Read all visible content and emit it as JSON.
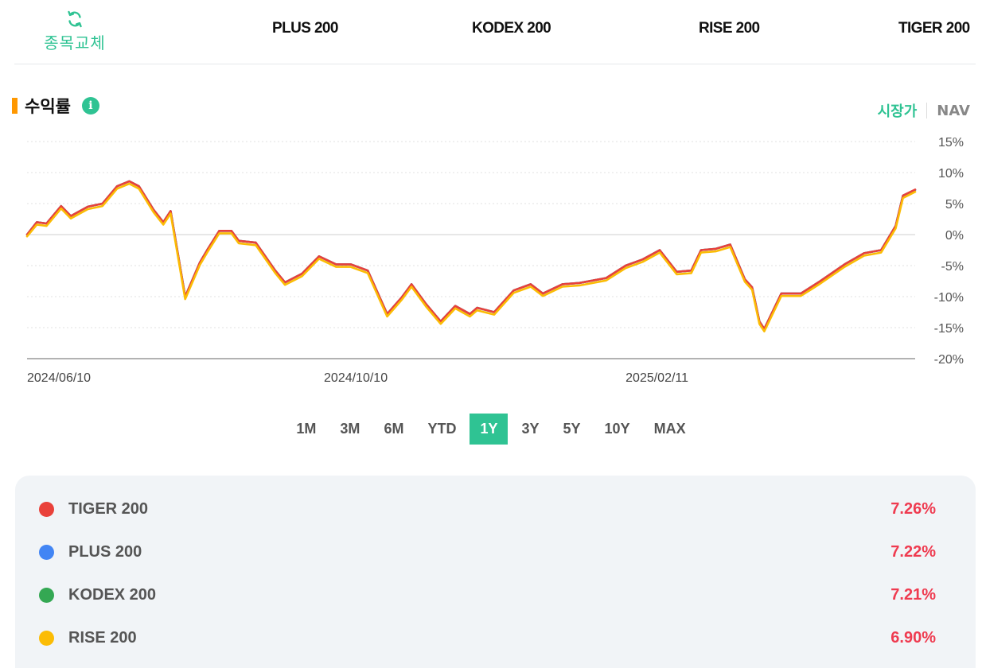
{
  "header": {
    "swap_label": "종목교체",
    "tabs": [
      "PLUS 200",
      "KODEX 200",
      "RISE 200",
      "TIGER 200"
    ]
  },
  "section": {
    "title": "수익률",
    "info_icon": "i",
    "toggle": {
      "active": "시장가",
      "inactive": "NAV"
    }
  },
  "periods": {
    "options": [
      "1M",
      "3M",
      "6M",
      "YTD",
      "1Y",
      "3Y",
      "5Y",
      "10Y",
      "MAX"
    ],
    "selected": "1Y"
  },
  "legend": [
    {
      "name": "TIGER 200",
      "value": "7.26%",
      "color": "#e9413a"
    },
    {
      "name": "PLUS 200",
      "value": "7.22%",
      "color": "#4285f4"
    },
    {
      "name": "KODEX 200",
      "value": "7.21%",
      "color": "#34a853"
    },
    {
      "name": "RISE 200",
      "value": "6.90%",
      "color": "#fbbc05"
    }
  ],
  "colors": {
    "accent": "#2fc393",
    "title_marker": "#ff9800",
    "positive": "#ef3b50"
  },
  "chart_data": {
    "type": "line",
    "y_unit": "%",
    "ylim": [
      -20,
      15
    ],
    "y_ticks": [
      15,
      10,
      5,
      0,
      -5,
      -10,
      -15,
      -20
    ],
    "y_tick_labels": [
      "15%",
      "10%",
      "5%",
      "0%",
      "-5%",
      "-10%",
      "-15%",
      "-20%"
    ],
    "x_start": "2024-06-10",
    "x_end": "2025-06-10",
    "x_tick_labels": [
      {
        "date": "2024-06-10",
        "label": "2024/06/10"
      },
      {
        "date": "2024-10-10",
        "label": "2024/10/10"
      },
      {
        "date": "2025-02-11",
        "label": "2025/02/11"
      }
    ],
    "x": [
      "2024-06-10",
      "2024-06-14",
      "2024-06-18",
      "2024-06-24",
      "2024-06-28",
      "2024-07-05",
      "2024-07-11",
      "2024-07-17",
      "2024-07-22",
      "2024-07-26",
      "2024-08-01",
      "2024-08-05",
      "2024-08-08",
      "2024-08-14",
      "2024-08-20",
      "2024-08-23",
      "2024-08-28",
      "2024-09-02",
      "2024-09-05",
      "2024-09-12",
      "2024-09-20",
      "2024-09-24",
      "2024-10-01",
      "2024-10-08",
      "2024-10-15",
      "2024-10-21",
      "2024-10-28",
      "2024-11-05",
      "2024-11-11",
      "2024-11-15",
      "2024-11-21",
      "2024-11-27",
      "2024-12-03",
      "2024-12-09",
      "2024-12-12",
      "2024-12-19",
      "2024-12-27",
      "2025-01-03",
      "2025-01-08",
      "2025-01-16",
      "2025-01-23",
      "2025-02-03",
      "2025-02-11",
      "2025-02-18",
      "2025-02-25",
      "2025-03-04",
      "2025-03-10",
      "2025-03-14",
      "2025-03-20",
      "2025-03-26",
      "2025-04-01",
      "2025-04-04",
      "2025-04-07",
      "2025-04-09",
      "2025-04-16",
      "2025-04-24",
      "2025-05-02",
      "2025-05-12",
      "2025-05-20",
      "2025-05-27",
      "2025-06-02",
      "2025-06-05",
      "2025-06-10"
    ],
    "series": [
      {
        "name": "TIGER 200",
        "color": "#e9413a",
        "values": [
          0,
          2,
          1.8,
          4.6,
          3,
          4.5,
          5,
          7.8,
          8.6,
          7.8,
          4,
          2,
          3.8,
          -10,
          -4.5,
          -2.5,
          0.6,
          0.6,
          -1,
          -1.3,
          -5.8,
          -7.7,
          -6.3,
          -3.5,
          -4.8,
          -4.8,
          -5.8,
          -12.8,
          -10.1,
          -8,
          -11.2,
          -14,
          -11.5,
          -12.8,
          -11.8,
          -12.5,
          -9,
          -8,
          -9.5,
          -8,
          -7.8,
          -7,
          -5,
          -4,
          -2.5,
          -6,
          -5.8,
          -2.5,
          -2.3,
          -1.6,
          -7.2,
          -8.5,
          -14,
          -15.2,
          -9.5,
          -9.5,
          -7.5,
          -4.8,
          -3,
          -2.5,
          1.4,
          6.3,
          7.26
        ]
      },
      {
        "name": "PLUS 200",
        "color": "#4285f4",
        "values": [
          0,
          2,
          1.8,
          4.6,
          3,
          4.5,
          5,
          7.8,
          8.6,
          7.8,
          4,
          2,
          3.8,
          -10,
          -4.5,
          -2.5,
          0.6,
          0.6,
          -1,
          -1.3,
          -5.8,
          -7.7,
          -6.3,
          -3.5,
          -4.8,
          -4.8,
          -5.8,
          -12.8,
          -10.1,
          -8,
          -11.2,
          -14,
          -11.5,
          -12.8,
          -11.8,
          -12.5,
          -9,
          -8,
          -9.5,
          -8,
          -7.8,
          -7,
          -5,
          -4,
          -2.5,
          -6,
          -5.8,
          -2.5,
          -2.3,
          -1.6,
          -7.2,
          -8.5,
          -14,
          -15.2,
          -9.5,
          -9.5,
          -7.5,
          -4.8,
          -3,
          -2.5,
          1.4,
          6.3,
          7.22
        ]
      },
      {
        "name": "KODEX 200",
        "color": "#34a853",
        "values": [
          0,
          2,
          1.8,
          4.6,
          3,
          4.5,
          5,
          7.8,
          8.6,
          7.8,
          4,
          2,
          3.8,
          -10,
          -4.5,
          -2.5,
          0.6,
          0.6,
          -1,
          -1.3,
          -5.8,
          -7.7,
          -6.3,
          -3.5,
          -4.8,
          -4.8,
          -5.8,
          -12.8,
          -10.1,
          -8,
          -11.2,
          -14,
          -11.5,
          -12.8,
          -11.8,
          -12.5,
          -9,
          -8,
          -9.5,
          -8,
          -7.8,
          -7,
          -5,
          -4,
          -2.5,
          -6,
          -5.8,
          -2.5,
          -2.3,
          -1.6,
          -7.2,
          -8.5,
          -14,
          -15.2,
          -9.5,
          -9.5,
          -7.5,
          -4.8,
          -3,
          -2.5,
          1.4,
          6.3,
          7.21
        ]
      },
      {
        "name": "RISE 200",
        "color": "#fbbc05",
        "values": [
          -0.3,
          1.6,
          1.4,
          4.2,
          2.6,
          4.1,
          4.6,
          7.4,
          8.2,
          7.4,
          3.6,
          1.6,
          3.4,
          -10.4,
          -4.9,
          -2.9,
          0.2,
          0.2,
          -1.4,
          -1.7,
          -6.2,
          -8.1,
          -6.7,
          -3.9,
          -5.2,
          -5.2,
          -6.2,
          -13.2,
          -10.5,
          -8.4,
          -11.6,
          -14.4,
          -11.9,
          -13.2,
          -12.2,
          -12.9,
          -9.4,
          -8.4,
          -9.9,
          -8.4,
          -8.2,
          -7.4,
          -5.4,
          -4.4,
          -2.9,
          -6.4,
          -6.2,
          -2.9,
          -2.7,
          -2,
          -7.6,
          -8.9,
          -14.4,
          -15.6,
          -9.9,
          -9.9,
          -7.9,
          -5.2,
          -3.4,
          -2.9,
          1,
          5.9,
          6.9
        ]
      }
    ],
    "grid": true,
    "legend": "bottom"
  }
}
